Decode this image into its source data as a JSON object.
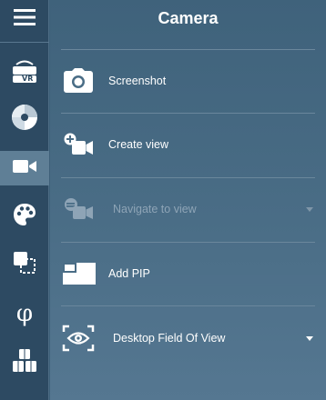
{
  "panel": {
    "title": "Camera"
  },
  "rail": {
    "items": [
      {
        "name": "menu-icon",
        "active": false
      },
      {
        "name": "vr-headset-icon",
        "label": "VR",
        "active": false
      },
      {
        "name": "disc-icon",
        "active": false
      },
      {
        "name": "video-camera-icon",
        "active": true
      },
      {
        "name": "palette-icon",
        "active": false
      },
      {
        "name": "selection-squares-icon",
        "active": false
      },
      {
        "name": "phi-icon",
        "label": "φ",
        "active": false
      },
      {
        "name": "cubes-icon",
        "active": false
      }
    ]
  },
  "items": [
    {
      "label": "Screenshot",
      "icon": "camera-icon",
      "enabled": true,
      "dropdown": false
    },
    {
      "label": "Create view",
      "icon": "add-video-icon",
      "enabled": true,
      "dropdown": false
    },
    {
      "label": "Navigate to view",
      "icon": "navigate-video-icon",
      "enabled": false,
      "dropdown": true
    },
    {
      "label": "Add PIP",
      "icon": "pip-icon",
      "enabled": true,
      "dropdown": false
    },
    {
      "label": "Desktop Field Of View",
      "icon": "field-of-view-icon",
      "enabled": true,
      "dropdown": true
    }
  ],
  "colors": {
    "rail_bg": "#2d4a62",
    "rail_active": "#5f7f96",
    "panel_bg": "#4a6d86",
    "text": "#ffffff",
    "disabled_text": "#8ea4b6"
  }
}
